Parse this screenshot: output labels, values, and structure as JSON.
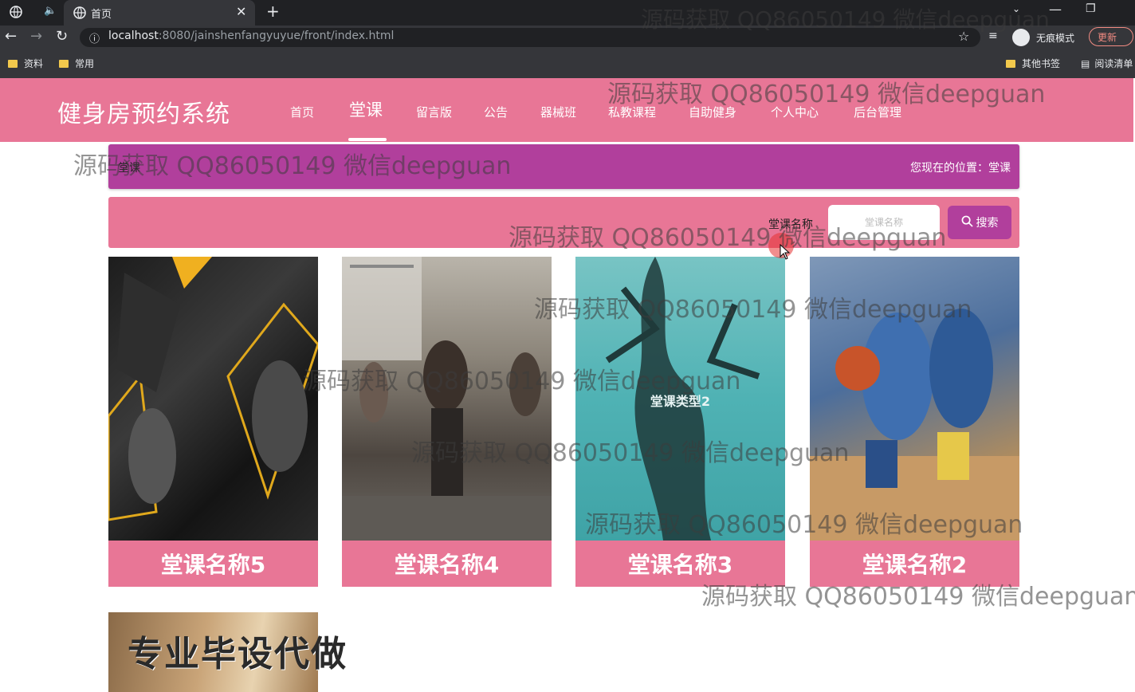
{
  "browser": {
    "tab_title": "首页",
    "url_host": "localhost",
    "url_path": ":8080/jainshenfangyuyue/front/index.html",
    "incognito_label": "无痕模式",
    "update_label": "更新",
    "bookmarks": [
      "资料",
      "常用"
    ],
    "other_bookmarks": "其他书签",
    "reading_list": "阅读清单"
  },
  "site": {
    "title": "健身房预约系统",
    "nav": [
      "首页",
      "堂课",
      "留言版",
      "公告",
      "器械班",
      "私教课程",
      "自助健身",
      "个人中心",
      "后台管理"
    ]
  },
  "breadcrumb": {
    "title": "堂课",
    "position": "您现在的位置：堂课"
  },
  "search": {
    "label": "堂课名称",
    "placeholder": "堂课名称",
    "button": "搜索"
  },
  "cards": [
    {
      "caption": "堂课名称5"
    },
    {
      "caption": "堂课名称4"
    },
    {
      "caption": "堂课名称3",
      "image_text": "堂课类型2"
    },
    {
      "caption": "堂课名称2"
    }
  ],
  "partial_card": {
    "image_text": "专业毕设代做"
  },
  "watermark": "源码获取 QQ86050149 微信deepguan",
  "colors": {
    "pink": "#e87696",
    "purple": "#b13f9c"
  }
}
